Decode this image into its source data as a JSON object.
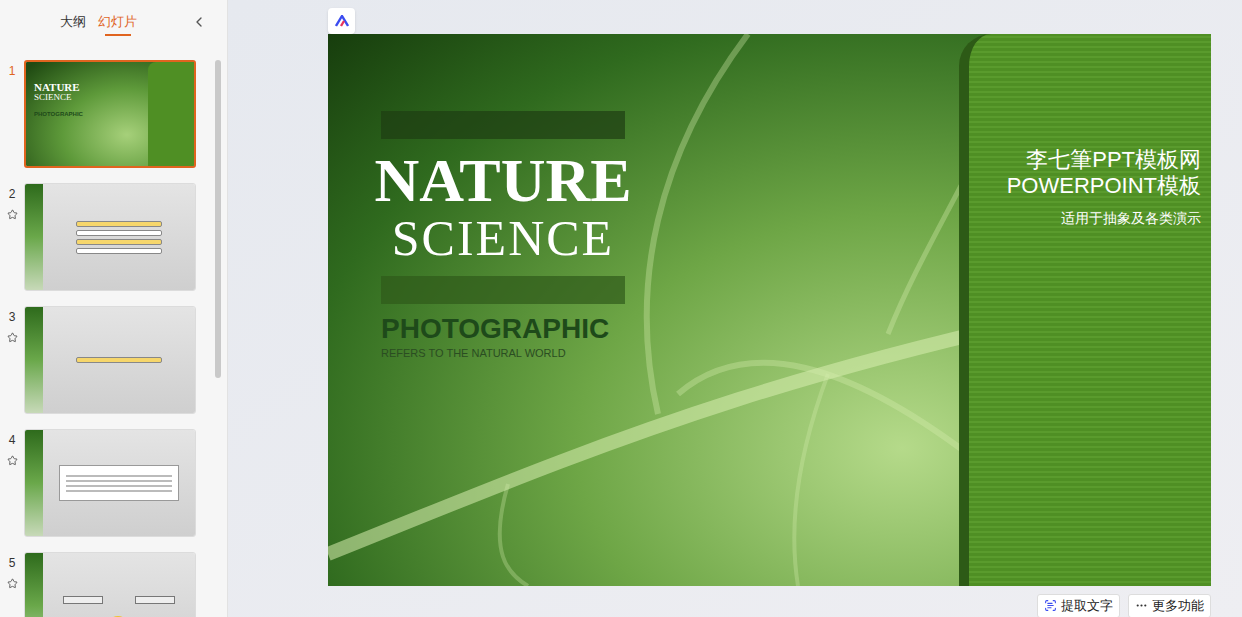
{
  "sidebar": {
    "tabs": [
      {
        "label": "大纲",
        "selected": false
      },
      {
        "label": "幻灯片",
        "selected": true
      }
    ]
  },
  "slides": [
    {
      "number": "1",
      "selected": true,
      "star_icon": false,
      "kind": "title"
    },
    {
      "number": "2",
      "selected": false,
      "star_icon": true,
      "kind": "list"
    },
    {
      "number": "3",
      "selected": false,
      "star_icon": true,
      "kind": "single"
    },
    {
      "number": "4",
      "selected": false,
      "star_icon": true,
      "kind": "text"
    },
    {
      "number": "5",
      "selected": false,
      "star_icon": true,
      "kind": "diagram"
    }
  ],
  "slide": {
    "title_lines": [
      "NATURE",
      "SCIENCE"
    ],
    "subtitle": "PHOTOGRAPHIC",
    "tagline": "REFERS TO THE NATURAL WORLD",
    "side_lines": [
      "李七筆PPT模板网",
      "POWERPOINT模板"
    ],
    "side_note": "适用于抽象及各类演示"
  },
  "toolbar": {
    "buttons": [
      {
        "label": "提取文字",
        "kind": "extract"
      },
      {
        "label": "更多功能",
        "kind": "more"
      }
    ]
  }
}
